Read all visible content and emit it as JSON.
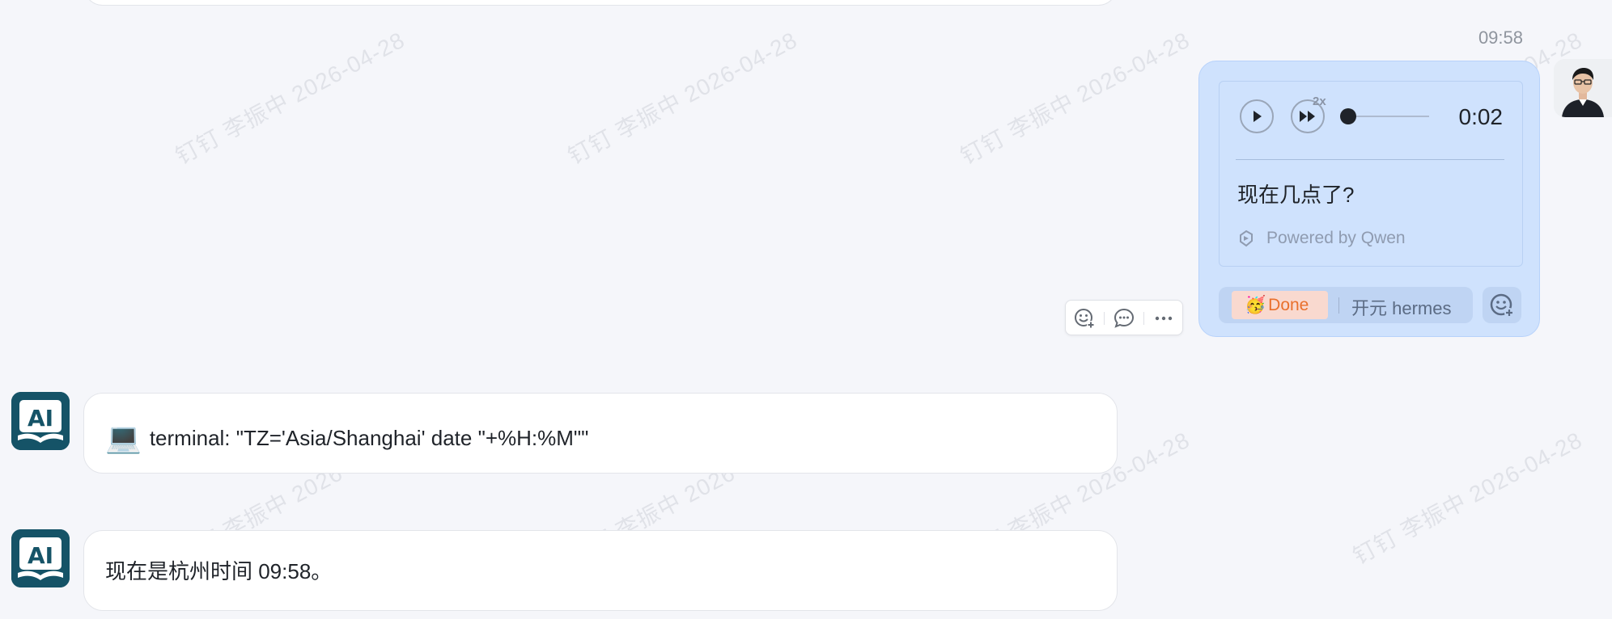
{
  "watermark": {
    "text": "钉钉 李振中 2026-04-28"
  },
  "user_message": {
    "time": "09:58",
    "voice": {
      "speed": "2x",
      "duration": "0:02",
      "progress": 0,
      "transcript": "现在几点了?",
      "powered_by": "Powered by Qwen"
    },
    "reaction": {
      "emoji": "🥳",
      "label": "Done",
      "users": "开元 hermes"
    }
  },
  "ai_messages": [
    {
      "icon": "💻",
      "text": "terminal: \"TZ='Asia/Shanghai' date \"+%H:%M\"\""
    },
    {
      "text": "现在是杭州时间 09:58。"
    }
  ],
  "colors": {
    "user_bubble": "#cfe2fd",
    "ai_avatar": "#155367",
    "reaction_accent": "#e9702c"
  }
}
